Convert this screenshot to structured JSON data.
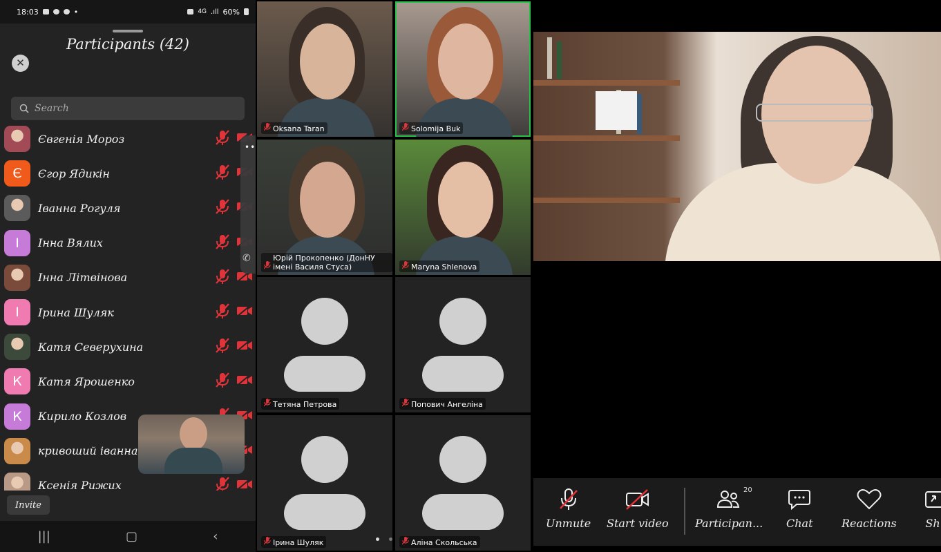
{
  "status_bar": {
    "time": "18:03",
    "network": "4G",
    "battery": "60%"
  },
  "participants_panel": {
    "title": "Participants (42)",
    "search_placeholder": "Search",
    "invite_label": "Invite",
    "participants": [
      {
        "name": "Євгенія Мороз",
        "initial": "",
        "avatar_color": "#a24b57",
        "photo": true
      },
      {
        "name": "Єгор Ядикін",
        "initial": "Є",
        "avatar_color": "#f05a1a",
        "photo": false
      },
      {
        "name": "Іванна Рогуля",
        "initial": "",
        "avatar_color": "#5b5b5b",
        "photo": true
      },
      {
        "name": "Інна Вялих",
        "initial": "І",
        "avatar_color": "#c77bd8",
        "photo": false
      },
      {
        "name": "Інна Літвінова",
        "initial": "",
        "avatar_color": "#7a4a3a",
        "photo": true
      },
      {
        "name": "Ірина Шуляк",
        "initial": "І",
        "avatar_color": "#f07bb0",
        "photo": false
      },
      {
        "name": "Катя Северухина",
        "initial": "",
        "avatar_color": "#3b4a3a",
        "photo": true
      },
      {
        "name": "Катя Ярошенко",
        "initial": "К",
        "avatar_color": "#f07bb0",
        "photo": false
      },
      {
        "name": "Кирило Козлов",
        "initial": "К",
        "avatar_color": "#c77bd8",
        "photo": false
      },
      {
        "name": "кривоший іванна",
        "initial": "",
        "avatar_color": "#c98a4a",
        "photo": true
      },
      {
        "name": "Ксенія Рижих",
        "initial": "",
        "avatar_color": "#b89a86",
        "photo": true
      }
    ]
  },
  "video_grid": {
    "tiles": [
      {
        "name": "Oksana Taran",
        "video": true,
        "bg": "#6b5a4c",
        "face": "#d8b49a",
        "hair": "#3a2e28",
        "active": false
      },
      {
        "name": "Solomija Buk",
        "video": true,
        "bg": "#a89a90",
        "face": "#dfb6a0",
        "hair": "#9a5a3a",
        "active": true
      },
      {
        "name": "Юрій Прокопенко (ДонНУ імені Василя Стуса)",
        "video": true,
        "bg": "#3a3f38",
        "face": "#d4a890",
        "hair": "#4a3a2e",
        "active": false
      },
      {
        "name": "Maryna Shlenova",
        "video": true,
        "bg": "#5a8a3a",
        "face": "#e4bfa6",
        "hair": "#3a2620",
        "active": false
      },
      {
        "name": "Тетяна Петрова",
        "video": false,
        "active": false
      },
      {
        "name": "Попович Ангеліна",
        "video": false,
        "active": false
      },
      {
        "name": "Ірина Шуляк",
        "video": false,
        "active": false
      },
      {
        "name": "Аліна Скольська",
        "video": false,
        "active": false
      }
    ]
  },
  "speaker_toolbar": {
    "unmute": "Unmute",
    "start_video": "Start video",
    "participants": "Participan...",
    "participants_count": "20",
    "chat": "Chat",
    "reactions": "Reactions",
    "share": "Sh"
  },
  "colors": {
    "muted_red": "#e0343a",
    "active_border": "#27c24a"
  }
}
